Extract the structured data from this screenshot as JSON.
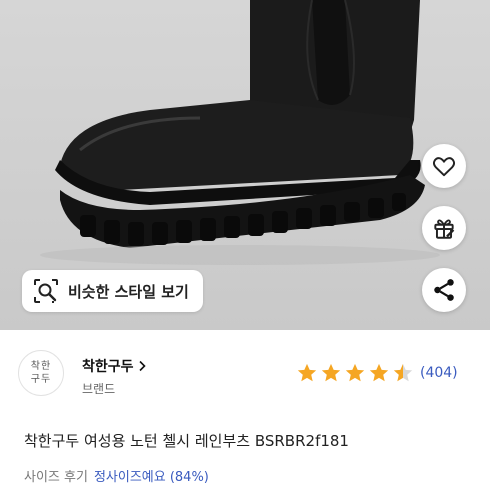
{
  "actions": {
    "similar_style_label": "비슷한 스타일 보기",
    "like_icon": "heart-icon",
    "gift_icon": "gift-icon",
    "share_icon": "share-icon",
    "search_icon": "image-search-icon"
  },
  "brand": {
    "logo_line1": "착한",
    "logo_line2": "구두",
    "name": "착한구두",
    "subtitle": "브랜드"
  },
  "rating": {
    "stars": 4.5,
    "max_stars": 5,
    "count_text": "(404)",
    "star_color": "#f5a623"
  },
  "product": {
    "title": "착한구두 여성용 노턴 첼시 레인부츠 BSRBR2f181"
  },
  "size_review": {
    "label": "사이즈 후기",
    "value": "정사이즈예요 (84%)"
  },
  "colors": {
    "accent_blue": "#3a5bbf",
    "boot": "#161616"
  }
}
